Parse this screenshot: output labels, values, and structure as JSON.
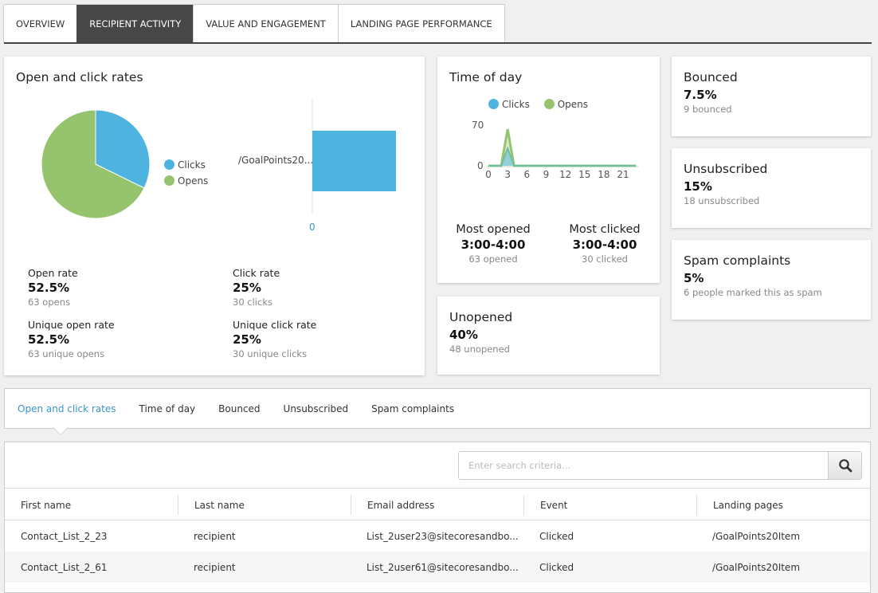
{
  "tabs": [
    {
      "label": "OVERVIEW"
    },
    {
      "label": "RECIPIENT ACTIVITY",
      "active": true
    },
    {
      "label": "VALUE AND ENGAGEMENT"
    },
    {
      "label": "LANDING PAGE PERFORMANCE"
    }
  ],
  "colors": {
    "clicks": "#4fb3e0",
    "opens": "#96c46e",
    "active_tab": "#474747",
    "link": "#3a94c8"
  },
  "open_click": {
    "title": "Open and click rates",
    "legend": {
      "clicks": "Clicks",
      "opens": "Opens"
    },
    "pie": {
      "clicks": 30,
      "opens": 63
    },
    "bar": {
      "category": "/GoalPoints20...",
      "value": 30,
      "axis_min": "0"
    },
    "stats": [
      {
        "label": "Open rate",
        "value": "52.5%",
        "sub": "63 opens"
      },
      {
        "label": "Click rate",
        "value": "25%",
        "sub": "30 clicks"
      },
      {
        "label": "Unique open rate",
        "value": "52.5%",
        "sub": "63 unique opens"
      },
      {
        "label": "Unique click rate",
        "value": "25%",
        "sub": "30 unique clicks"
      }
    ]
  },
  "time_of_day": {
    "title": "Time of day",
    "legend": {
      "clicks": "Clicks",
      "opens": "Opens"
    },
    "y_ticks": [
      "70",
      "0"
    ],
    "x_ticks": [
      "0",
      "3",
      "6",
      "9",
      "12",
      "15",
      "18",
      "21"
    ],
    "chart_data": {
      "type": "area",
      "x": [
        0,
        1,
        2,
        3,
        4,
        5,
        6,
        7,
        8,
        9,
        10,
        11,
        12,
        13,
        14,
        15,
        16,
        17,
        18,
        19,
        20,
        21,
        22,
        23
      ],
      "series": [
        {
          "name": "Clicks",
          "values": [
            0,
            0,
            0,
            30,
            0,
            0,
            0,
            0,
            0,
            0,
            0,
            0,
            0,
            0,
            0,
            0,
            0,
            0,
            0,
            0,
            0,
            0,
            0,
            0
          ]
        },
        {
          "name": "Opens",
          "values": [
            0,
            0,
            0,
            63,
            0,
            0,
            0,
            0,
            0,
            0,
            0,
            0,
            0,
            0,
            0,
            0,
            0,
            0,
            0,
            0,
            0,
            0,
            0,
            0
          ]
        }
      ],
      "ylim": [
        0,
        70
      ]
    },
    "most_opened": {
      "label": "Most opened",
      "value": "3:00-4:00",
      "sub": "63 opened"
    },
    "most_clicked": {
      "label": "Most clicked",
      "value": "3:00-4:00",
      "sub": "30 clicked"
    }
  },
  "unopened": {
    "title": "Unopened",
    "value": "40%",
    "sub": "48 unopened"
  },
  "bounced": {
    "title": "Bounced",
    "value": "7.5%",
    "sub": "9 bounced"
  },
  "unsubscribed": {
    "title": "Unsubscribed",
    "value": "15%",
    "sub": "18 unsubscribed"
  },
  "spam": {
    "title": "Spam complaints",
    "value": "5%",
    "sub": "6 people marked this as spam"
  },
  "subtabs": [
    {
      "label": "Open and click rates",
      "active": true
    },
    {
      "label": "Time of day"
    },
    {
      "label": "Bounced"
    },
    {
      "label": "Unsubscribed"
    },
    {
      "label": "Spam complaints"
    }
  ],
  "search": {
    "placeholder": "Enter search criteria...",
    "icon": "search-icon"
  },
  "table": {
    "columns": [
      "First name",
      "Last name",
      "Email address",
      "Event",
      "Landing pages"
    ],
    "rows": [
      [
        "Contact_List_2_23",
        "recipient",
        "List_2user23@sitecoresandbo...",
        "Clicked",
        "/GoalPoints20Item"
      ],
      [
        "Contact_List_2_61",
        "recipient",
        "List_2user61@sitecoresandbo...",
        "Clicked",
        "/GoalPoints20Item"
      ]
    ]
  }
}
